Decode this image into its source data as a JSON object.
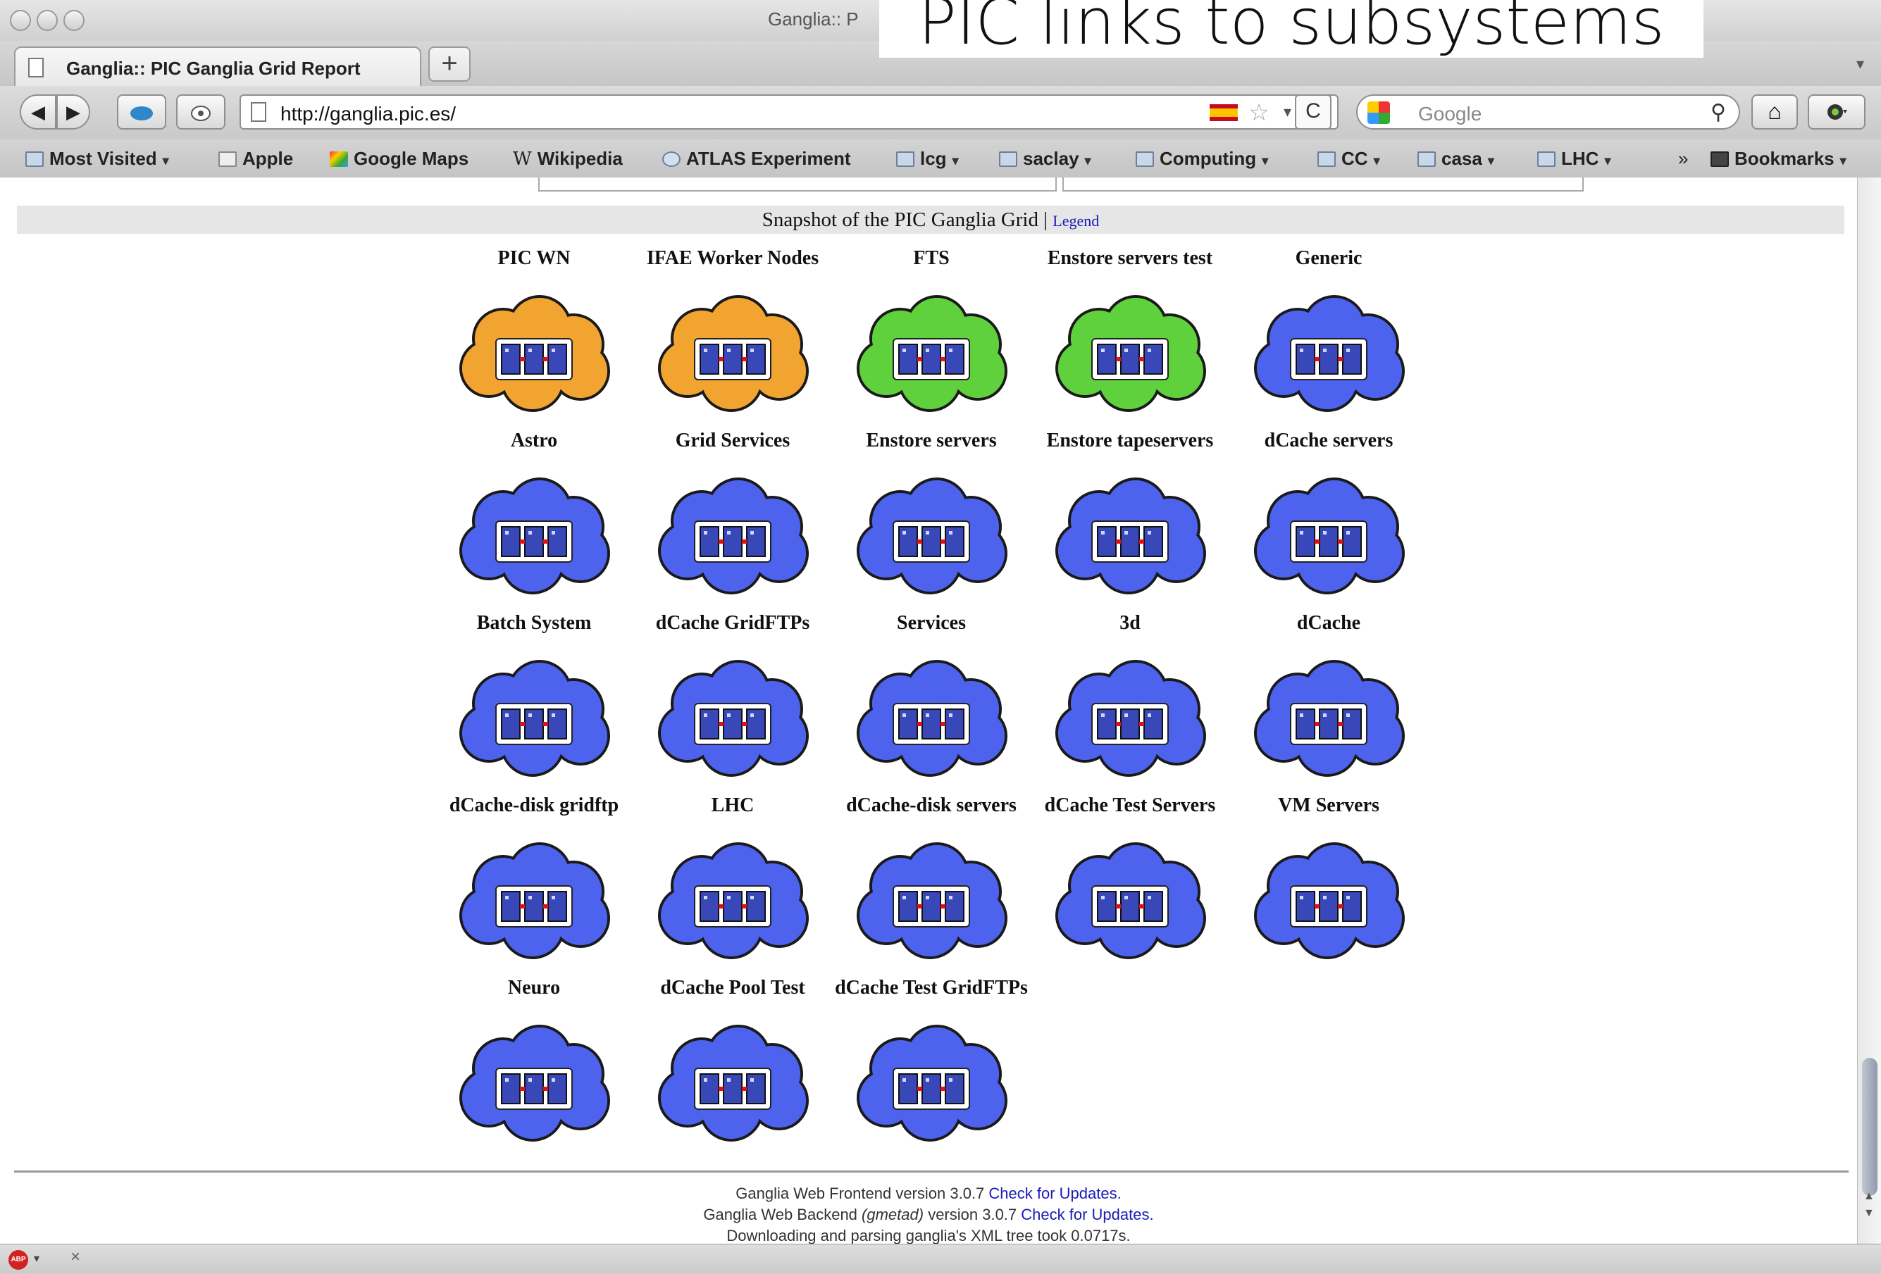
{
  "window": {
    "title": "Ganglia:: P",
    "caption_overlay": "PIC links to subsystems"
  },
  "tabs": [
    {
      "label": "Ganglia:: PIC Ganglia Grid Report"
    }
  ],
  "tabbar": {
    "new_tab_label": "+",
    "list_arrow": "▾"
  },
  "navbar": {
    "url": "http://ganglia.pic.es/",
    "search_placeholder": "Google",
    "back_glyph": "◀",
    "forward_glyph": "▶",
    "reload_glyph": "C",
    "home_glyph": "⌂",
    "star_glyph": "☆",
    "drop_glyph": "▾",
    "mag_glyph": "⚲"
  },
  "bookmarks": [
    {
      "label": "Most Visited",
      "menu": true,
      "icon": "folder-icon"
    },
    {
      "label": "Apple",
      "menu": false,
      "icon": "apple-icon"
    },
    {
      "label": "Google Maps",
      "menu": false,
      "icon": "google-maps-icon"
    },
    {
      "label": "Wikipedia",
      "menu": false,
      "icon": "wikipedia-icon"
    },
    {
      "label": "ATLAS Experiment",
      "menu": false,
      "icon": "atlas-icon"
    },
    {
      "label": "lcg",
      "menu": true,
      "icon": "folder-icon"
    },
    {
      "label": "saclay",
      "menu": true,
      "icon": "folder-icon"
    },
    {
      "label": "Computing",
      "menu": true,
      "icon": "folder-icon"
    },
    {
      "label": "CC",
      "menu": true,
      "icon": "folder-icon"
    },
    {
      "label": "casa",
      "menu": true,
      "icon": "folder-icon"
    },
    {
      "label": "LHC",
      "menu": true,
      "icon": "folder-icon"
    }
  ],
  "bookmarks_overflow": "»",
  "bookmarks_menu": "Bookmarks",
  "page": {
    "snapshot_title": "Snapshot of the PIC Ganglia Grid",
    "legend_link": "Legend",
    "separator": "|"
  },
  "status_colors": {
    "orange": "#f2a431",
    "green": "#5fd13c",
    "blue": "#4d63ee"
  },
  "clusters": [
    {
      "name": "PIC WN",
      "status": "orange"
    },
    {
      "name": "IFAE Worker Nodes",
      "status": "orange"
    },
    {
      "name": "FTS",
      "status": "green"
    },
    {
      "name": "Enstore servers test",
      "status": "green"
    },
    {
      "name": "Generic",
      "status": "blue"
    },
    {
      "name": "Astro",
      "status": "blue"
    },
    {
      "name": "Grid Services",
      "status": "blue"
    },
    {
      "name": "Enstore servers",
      "status": "blue"
    },
    {
      "name": "Enstore tapeservers",
      "status": "blue"
    },
    {
      "name": "dCache servers",
      "status": "blue"
    },
    {
      "name": "Batch System",
      "status": "blue"
    },
    {
      "name": "dCache GridFTPs",
      "status": "blue"
    },
    {
      "name": "Services",
      "status": "blue"
    },
    {
      "name": "3d",
      "status": "blue"
    },
    {
      "name": "dCache",
      "status": "blue"
    },
    {
      "name": "dCache-disk gridftp",
      "status": "blue"
    },
    {
      "name": "LHC",
      "status": "blue"
    },
    {
      "name": "dCache-disk servers",
      "status": "blue"
    },
    {
      "name": "dCache Test Servers",
      "status": "blue"
    },
    {
      "name": "VM Servers",
      "status": "blue"
    },
    {
      "name": "Neuro",
      "status": "blue"
    },
    {
      "name": "dCache Pool Test",
      "status": "blue"
    },
    {
      "name": "dCache Test GridFTPs",
      "status": "blue"
    }
  ],
  "footer": {
    "line1_text": "Ganglia Web Frontend version 3.0.7 ",
    "line2_pre": "Ganglia Web Backend ",
    "line2_em": "(gmetad)",
    "line2_post": " version 3.0.7 ",
    "check_link": "Check for Updates.",
    "line3_text": "Downloading and parsing ganglia's XML tree took 0.0717s."
  },
  "statusbar": {
    "abp_label": "ABP",
    "drop_glyph": "▾",
    "close_glyph": "×"
  }
}
